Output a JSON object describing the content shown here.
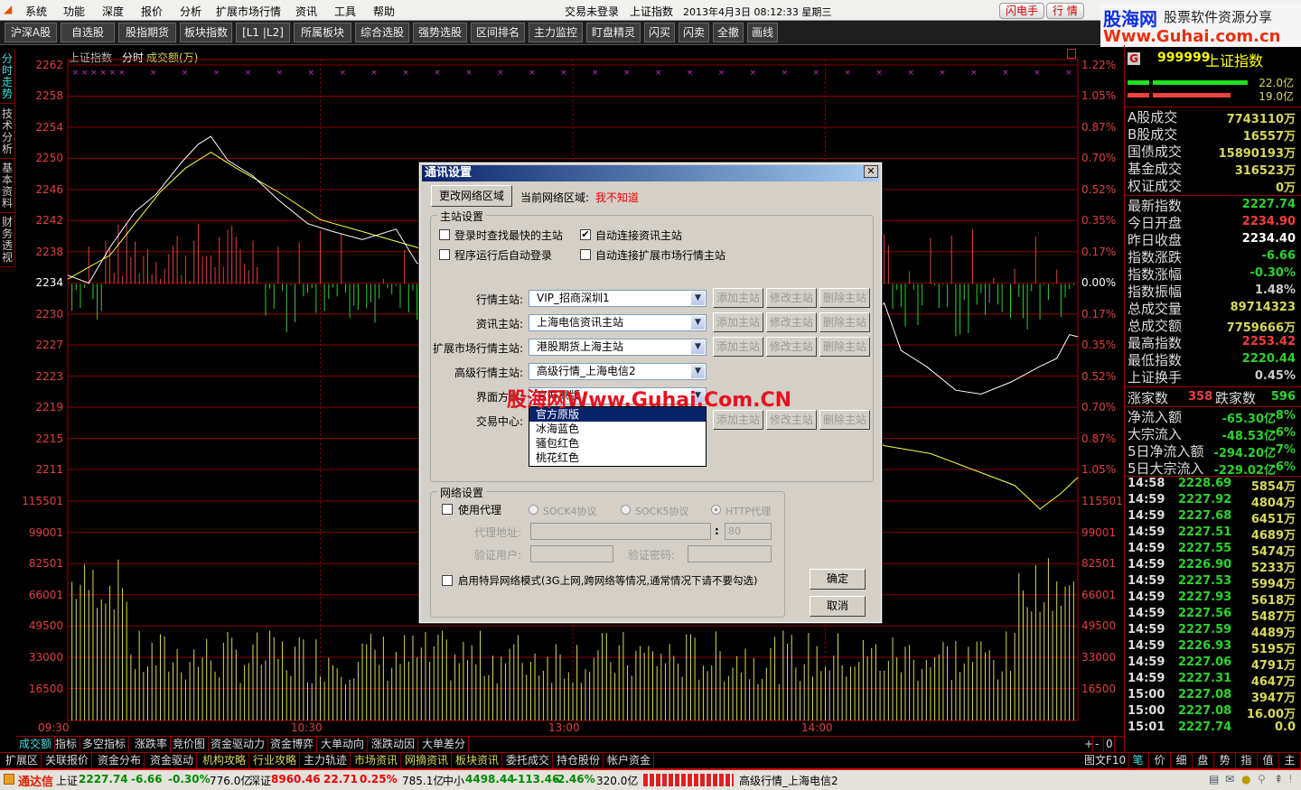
{
  "menu": {
    "items": [
      "系统",
      "功能",
      "深度",
      "报价",
      "分析",
      "扩展市场行情",
      "资讯",
      "工具",
      "帮助"
    ],
    "status_login": "交易未登录",
    "status_index": "上证指数",
    "status_datetime": "2013年4月3日 08:12:33 星期三",
    "btn_flash": "闪电手",
    "btn_quote": "行  情"
  },
  "logo": {
    "cn": "股海网",
    "slogan": "股票软件资源分享",
    "url": "Www.Guhai.com.cn"
  },
  "toolbar": [
    "沪深A股",
    "自选股",
    "股指期货",
    "板块指数",
    "[L1 |L2]",
    "所属板块",
    "综合选股",
    "强势选股",
    "区间排名",
    "主力监控",
    "盯盘精灵",
    "闪买",
    "闪卖",
    "全撤",
    "画线"
  ],
  "side_tabs": [
    "分时走势",
    "技术分析",
    "基本资料",
    "财务透视"
  ],
  "chart_header": {
    "name": "上证指数",
    "mode": "分时",
    "indicator": "成交额(万)"
  },
  "chart_data": {
    "type": "line",
    "price_ticks": [
      "2262",
      "2258",
      "2254",
      "2250",
      "2246",
      "2242",
      "2238",
      "2234",
      "2230",
      "2227",
      "2223",
      "2219",
      "2215",
      "2211"
    ],
    "pct_ticks": [
      "1.22%",
      "1.05%",
      "0.87%",
      "0.70%",
      "0.52%",
      "0.35%",
      "0.17%",
      "0.00%",
      "0.17%",
      "0.35%",
      "0.52%",
      "0.70%",
      "0.87%",
      "1.05%"
    ],
    "volume_ticks": [
      "115501",
      "99001",
      "82501",
      "66001",
      "49500",
      "33000",
      "16500"
    ],
    "time_ticks": [
      "09:30",
      "10:30",
      "13:00",
      "14:00"
    ],
    "ylim": [
      2211,
      2262
    ],
    "prev_close": 2234.4,
    "price_series": [
      [
        0,
        2235.5
      ],
      [
        5,
        2234.5
      ],
      [
        10,
        2239
      ],
      [
        16,
        2243.5
      ],
      [
        21,
        2245.7
      ],
      [
        27,
        2249.7
      ],
      [
        31,
        2252
      ],
      [
        34,
        2253
      ],
      [
        38,
        2250
      ],
      [
        44,
        2248
      ],
      [
        50,
        2245
      ],
      [
        57,
        2242
      ],
      [
        63,
        2241
      ],
      [
        70,
        2240
      ],
      [
        78,
        2241.3
      ],
      [
        83,
        2237
      ],
      [
        100,
        2235
      ],
      [
        120,
        2233
      ],
      [
        150,
        2232
      ],
      [
        190,
        2230
      ],
      [
        194,
        2232
      ],
      [
        198,
        2226
      ],
      [
        204,
        2224
      ],
      [
        211,
        2221
      ],
      [
        217,
        2220.5
      ],
      [
        224,
        2222
      ],
      [
        231,
        2224
      ],
      [
        235,
        2225
      ],
      [
        238,
        2228
      ],
      [
        240,
        2227.74
      ]
    ],
    "avg_series": [
      [
        0,
        2235
      ],
      [
        10,
        2238
      ],
      [
        16,
        2242
      ],
      [
        22,
        2246
      ],
      [
        28,
        2249
      ],
      [
        34,
        2251
      ],
      [
        40,
        2249
      ],
      [
        50,
        2246
      ],
      [
        60,
        2242.5
      ],
      [
        70,
        2241
      ],
      [
        83,
        2239
      ],
      [
        120,
        2232
      ],
      [
        160,
        2224
      ],
      [
        194,
        2214
      ],
      [
        205,
        2213
      ],
      [
        215,
        2211
      ],
      [
        225,
        2209
      ],
      [
        231,
        2206
      ],
      [
        236,
        2208
      ],
      [
        240,
        2210
      ]
    ]
  },
  "right_panel": {
    "code": "999999",
    "name": "上证指数",
    "badge": "G",
    "bar1_value": "22.0亿",
    "bar2_value": "19.0亿",
    "turnover": [
      {
        "k": "A股成交",
        "v": "7743110万"
      },
      {
        "k": "B股成交",
        "v": "16557万"
      },
      {
        "k": "国债成交",
        "v": "15890193万"
      },
      {
        "k": "基金成交",
        "v": "316523万"
      },
      {
        "k": "权证成交",
        "v": "0万"
      }
    ],
    "stats": [
      {
        "k": "最新指数",
        "v": "2227.74",
        "c": "g"
      },
      {
        "k": "今日开盘",
        "v": "2234.90",
        "c": "r"
      },
      {
        "k": "昨日收盘",
        "v": "2234.40",
        "c": "w"
      },
      {
        "k": "指数涨跌",
        "v": "-6.66",
        "c": "g"
      },
      {
        "k": "指数涨幅",
        "v": "-0.30%",
        "c": "g"
      },
      {
        "k": "指数振幅",
        "v": "1.48%",
        "c": "gr"
      },
      {
        "k": "总成交量",
        "v": "89714323",
        "c": "y"
      },
      {
        "k": "总成交额",
        "v": "7759666万",
        "c": "y"
      },
      {
        "k": "最高指数",
        "v": "2253.42",
        "c": "r"
      },
      {
        "k": "最低指数",
        "v": "2220.44",
        "c": "g"
      },
      {
        "k": "上证换手",
        "v": "0.45%",
        "c": "gr"
      }
    ],
    "up_label": "涨家数",
    "up_count": "358",
    "down_label": "跌家数",
    "down_count": "596",
    "flows": [
      {
        "k": "净流入额",
        "v": "-65.30亿",
        "p": "-8%"
      },
      {
        "k": "大宗流入",
        "v": "-48.53亿",
        "p": "-6%"
      },
      {
        "k": "5日净流入额",
        "v": "-294.20亿",
        "p": "-7%"
      },
      {
        "k": "5日大宗流入",
        "v": "-229.02亿",
        "p": "-6%"
      }
    ],
    "ticks": [
      [
        "14:58",
        "2228.69",
        "5854万"
      ],
      [
        "14:59",
        "2227.92",
        "4804万"
      ],
      [
        "14:59",
        "2227.68",
        "6451万"
      ],
      [
        "14:59",
        "2227.51",
        "4689万"
      ],
      [
        "14:59",
        "2227.55",
        "5474万"
      ],
      [
        "14:59",
        "2226.90",
        "5233万"
      ],
      [
        "14:59",
        "2227.53",
        "5994万"
      ],
      [
        "14:59",
        "2227.93",
        "5618万"
      ],
      [
        "14:59",
        "2227.56",
        "5487万"
      ],
      [
        "14:59",
        "2227.59",
        "4489万"
      ],
      [
        "14:59",
        "2226.93",
        "5195万"
      ],
      [
        "14:59",
        "2227.06",
        "4791万"
      ],
      [
        "14:59",
        "2227.31",
        "4647万"
      ],
      [
        "15:00",
        "2227.08",
        "3947万"
      ],
      [
        "15:00",
        "2227.08",
        "16.00万"
      ],
      [
        "15:01",
        "2227.74",
        "0.0"
      ]
    ]
  },
  "bottom_tabs": [
    "成交额",
    "指标",
    "多空指标",
    "涨跌率",
    "竞价图",
    "资金驱动力",
    "资金博弈",
    "大单动向",
    "涨跌动因",
    "大单差分"
  ],
  "zoom_btns": [
    "+",
    "-",
    "0"
  ],
  "ext_tabs": [
    "扩展区",
    "关联报价",
    "资金分布",
    "资金驱动",
    "机构攻略",
    "行业攻略",
    "主力轨迹",
    "市场资讯",
    "网摘资讯",
    "板块资讯",
    "委托成交",
    "持仓股份",
    "帐户资金"
  ],
  "f10": "图文F10",
  "right_tabs": [
    "笔",
    "价",
    "细",
    "盘",
    "势",
    "指",
    "值",
    "主"
  ],
  "status": {
    "brand": "通达信",
    "sh_label": "上证",
    "sh": "2227.74",
    "sh_chg": "-6.66",
    "sh_pct": "-0.30%",
    "sh_amt": "776.0亿",
    "sz_label": "深证",
    "sz": "8960.46",
    "sz_chg": "22.71",
    "sz_pct": "0.25%",
    "sz_amt": "785.1亿",
    "zx_label": "中小",
    "zx": "4498.44",
    "zx_chg": "-113.46",
    "zx_pct": "-2.46%",
    "zx_amt": "320.0亿",
    "server": "高级行情_上海电信2"
  },
  "dialog": {
    "title": "通讯设置",
    "change_region": "更改网络区域",
    "region_label": "当前网络区域:",
    "region_value": "我不知道",
    "group_main": "主站设置",
    "cb_fastest": "登录时查找最快的主站",
    "cb_autologin": "程序运行后自动登录",
    "cb_info": "自动连接资讯主站",
    "cb_ext": "自动连接扩展市场行情主站",
    "rows": [
      {
        "label": "行情主站:",
        "value": "VIP_招商深圳1"
      },
      {
        "label": "资讯主站:",
        "value": "上海电信资讯主站"
      },
      {
        "label": "扩展市场行情主站:",
        "value": "港股期货上海主站"
      },
      {
        "label": "高级行情主站:",
        "value": "高级行情_上海电信2"
      },
      {
        "label": "界面方案:",
        "value": "官方原版"
      },
      {
        "label": "交易中心:",
        "value": ""
      }
    ],
    "add": "添加主站",
    "edit": "修改主站",
    "del": "删除主站",
    "options": [
      "官方原版",
      "冰海蓝色",
      "骚包红色",
      "桃花红色"
    ],
    "watermark": "股海网Www.Guhai.Com.CN",
    "group_net": "网络设置",
    "cb_proxy": "使用代理",
    "sock4": "SOCK4协议",
    "sock5": "SOCK5协议",
    "http": "HTTP代理",
    "proxy_addr": "代理地址:",
    "port": "80",
    "auth_user": "验证用户:",
    "auth_pwd": "验证密码:",
    "cb_special": "启用特异网络模式(3G上网,跨网络等情况,通常情况下请不要勾选)",
    "ok": "确定",
    "cancel": "取消"
  }
}
